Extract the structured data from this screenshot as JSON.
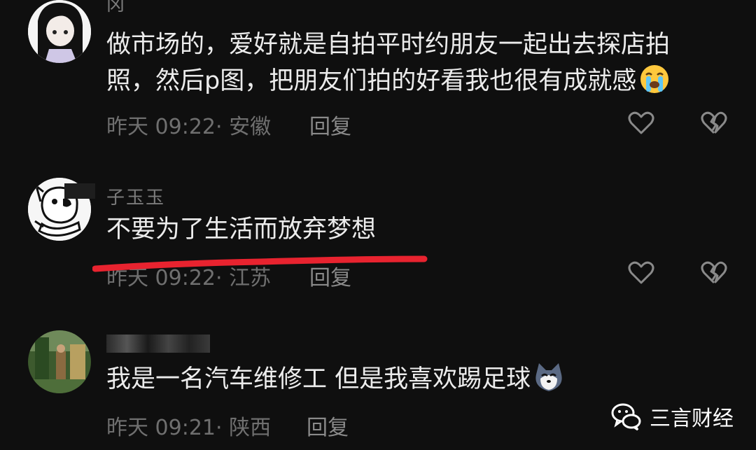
{
  "comments": [
    {
      "username": "冈",
      "text_line1": "做市场的，爱好就是自拍平时约朋友一起出去探店拍",
      "text_line2": "照，然后p图，把朋友们拍的好看我也很有成就感",
      "emoji": "loudly-crying-face",
      "timestamp": "昨天 09:22· 安徽",
      "reply_label": "回复"
    },
    {
      "username": "子玉玉",
      "text": "不要为了生活而放弃梦想",
      "timestamp": "昨天 09:22· 江苏",
      "reply_label": "回复"
    },
    {
      "username": "",
      "text": "我是一名汽车维修工 但是我喜欢踢足球",
      "emoji": "husky-dog-face",
      "timestamp": "昨天 09:21· 陕西",
      "reply_label": "回复"
    }
  ],
  "watermark": {
    "text": "三言财经"
  },
  "colors": {
    "background": "#0f0f0f",
    "highlight_underline": "#e8232f"
  }
}
